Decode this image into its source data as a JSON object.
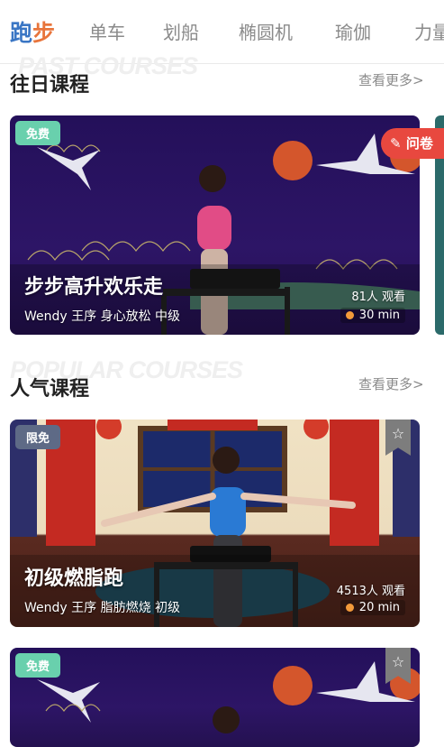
{
  "tabs": [
    {
      "label": "跑步",
      "active": true
    },
    {
      "label": "单车"
    },
    {
      "label": "划船"
    },
    {
      "label": "椭圆机"
    },
    {
      "label": "瑜伽"
    },
    {
      "label": "力量"
    }
  ],
  "past_section": {
    "ghost_text": "PAST COURSES",
    "title": "往日课程",
    "see_more": "查看更多>"
  },
  "popular_section": {
    "ghost_text": "POPULAR COURSES",
    "title": "人气课程",
    "see_more": "查看更多>"
  },
  "feedback_button": {
    "label": "问卷"
  },
  "cards": [
    {
      "badge": "免费",
      "title": "步步高升欢乐走",
      "meta": "Wendy 王序  身心放松  中级",
      "views": "81人 观看",
      "duration": "30 min"
    },
    {
      "badge": "限免",
      "title": "初级燃脂跑",
      "meta": "Wendy 王序  脂肪燃烧  初级",
      "views": "4513人 观看",
      "duration": "20 min"
    },
    {
      "badge": "免费"
    }
  ],
  "colors": {
    "tab_active_blue": "#3a76c4",
    "tab_active_orange": "#e8753c",
    "feedback_red": "#e8483f",
    "badge_free": "#69d0ad",
    "badge_limited": "#5e6a86"
  }
}
